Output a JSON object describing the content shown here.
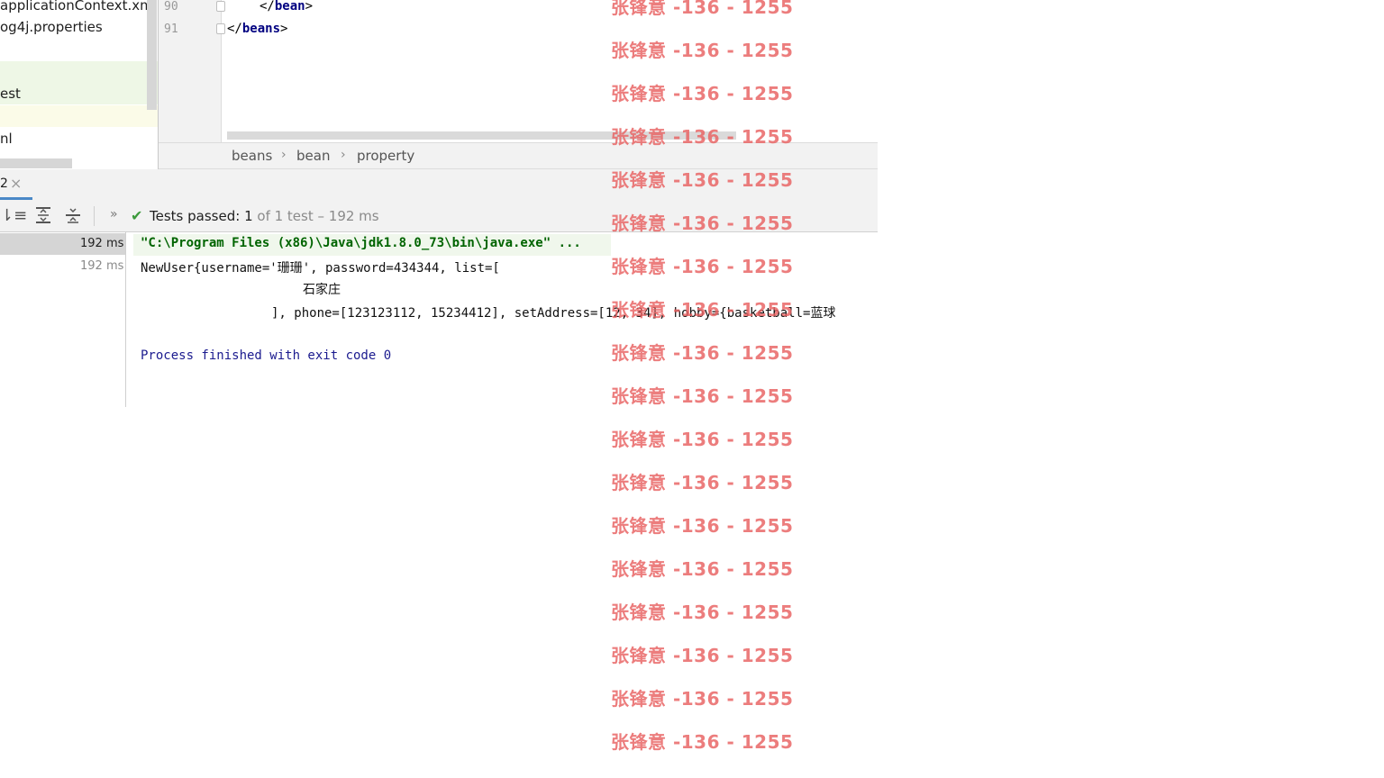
{
  "project_tree": {
    "items": [
      {
        "label": "applicationContext.xml"
      },
      {
        "label": "og4j.properties"
      },
      {
        "label": ""
      },
      {
        "label": "est"
      },
      {
        "label": ""
      },
      {
        "label": "nl"
      }
    ]
  },
  "editor": {
    "lines": [
      {
        "number": "90",
        "open": "</",
        "tag": "bean",
        "close": ">"
      },
      {
        "number": "91",
        "open": "</",
        "tag": "beans",
        "close": ">"
      }
    ]
  },
  "breadcrumb": {
    "items": [
      "beans",
      "bean",
      "property"
    ],
    "separator": "›"
  },
  "run_panel": {
    "tab_label": "2",
    "tab_close": "×",
    "more_glyph": "»",
    "status_check": "✔",
    "tests_passed_label": "Tests passed:",
    "tests_passed_count": "1",
    "tests_rest": "of 1 test – 192 ms",
    "test_times": [
      "192 ms",
      "192 ms"
    ]
  },
  "console": {
    "command": "\"C:\\Program Files (x86)\\Java\\jdk1.8.0_73\\bin\\java.exe\" ...",
    "output_line_1": "NewUser{username='珊珊', password=434344, list=[",
    "output_line_2": "石家庄",
    "output_line_3": "], phone=[123123112, 15234412], setAddress=[12, 34], hobby={basketball=蓝球",
    "process_finished": "Process finished with exit code 0"
  },
  "watermark": {
    "text": "张锋意 -136 - 1255",
    "color": "#e86060"
  },
  "colors": {
    "panel_bg": "#f2f2f2",
    "xml_tag": "#000080",
    "console_command": "#006400",
    "tests_passed_check": "#3c9a3c",
    "tab_underline": "#4a88c7"
  }
}
